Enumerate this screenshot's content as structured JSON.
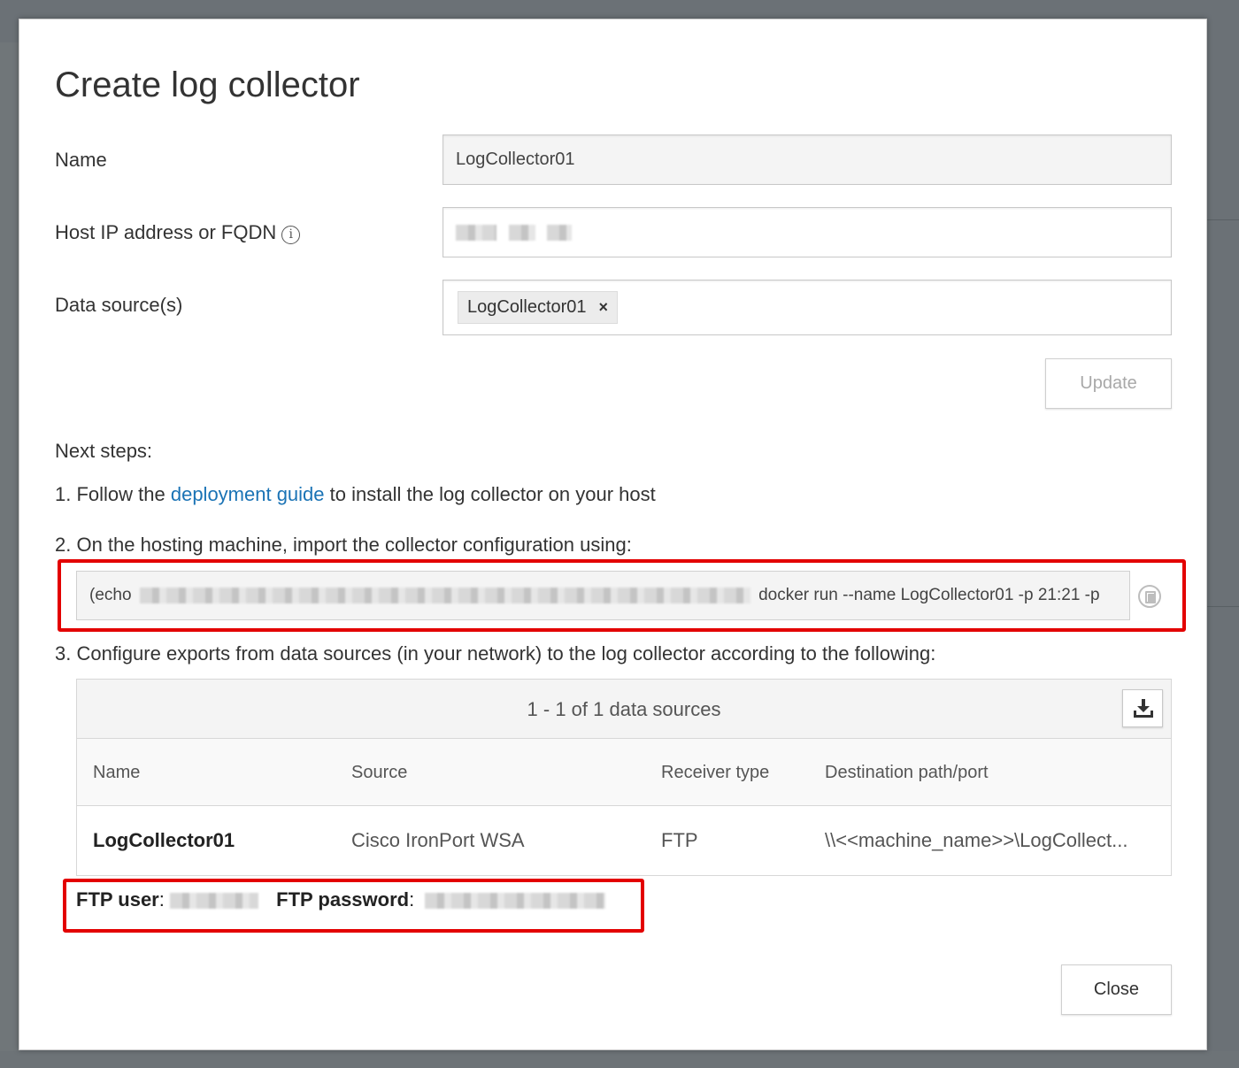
{
  "dialog": {
    "title": "Create log collector",
    "fields": {
      "name_label": "Name",
      "name_value": "LogCollector01",
      "host_label": "Host IP address or FQDN",
      "data_sources_label": "Data source(s)",
      "data_source_chip": "LogCollector01",
      "chip_remove": "×"
    },
    "update_button": "Update",
    "next_steps": {
      "heading": "Next steps:",
      "step1_prefix": "1. Follow the ",
      "step1_link": "deployment guide",
      "step1_suffix": " to install the log collector on your host",
      "step2": "2. On the hosting machine, import the collector configuration using:",
      "command_prefix": "(echo",
      "command_suffix": "docker run --name LogCollector01 -p 21:21 -p",
      "step3": "3. Configure exports from data sources (in your network) to the log collector according to the following:"
    },
    "table": {
      "count_text": "1 - 1 of 1 data sources",
      "columns": [
        "Name",
        "Source",
        "Receiver type",
        "Destination path/port"
      ],
      "rows": [
        [
          "LogCollector01",
          "Cisco IronPort WSA",
          "FTP",
          "\\\\<<machine_name>>\\LogCollect..."
        ]
      ]
    },
    "ftp": {
      "user_label": "FTP user",
      "password_label": "FTP password",
      "colon": ":"
    },
    "close_button": "Close"
  },
  "colors": {
    "link": "#1a73b5",
    "highlight": "#e30000"
  }
}
